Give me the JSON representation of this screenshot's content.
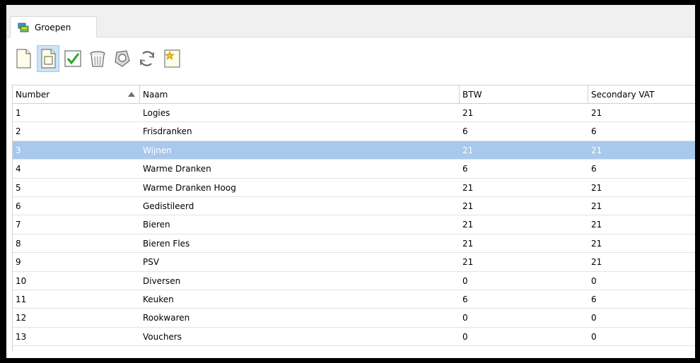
{
  "tab": {
    "label": "Groepen",
    "icon": "groups-icon"
  },
  "toolbar": {
    "buttons": [
      {
        "name": "new-button",
        "icon": "new-document-icon"
      },
      {
        "name": "edit-button",
        "icon": "edit-document-icon",
        "active": true
      },
      {
        "name": "confirm-button",
        "icon": "checkmark-icon"
      },
      {
        "name": "delete-button",
        "icon": "trash-icon"
      },
      {
        "name": "search-button",
        "icon": "search-icon"
      },
      {
        "name": "refresh-button",
        "icon": "refresh-icon"
      },
      {
        "name": "favorite-button",
        "icon": "star-icon"
      }
    ]
  },
  "table": {
    "columns": [
      "Number",
      "Naam",
      "BTW",
      "Secondary VAT"
    ],
    "sorted_column": "Number",
    "sort_direction": "ascending",
    "selected_row": "3",
    "rows": [
      [
        "1",
        "Logies",
        "21",
        "21"
      ],
      [
        "2",
        "Frisdranken",
        "6",
        "6"
      ],
      [
        "3",
        "Wijnen",
        "21",
        "21"
      ],
      [
        "4",
        "Warme Dranken",
        "6",
        "6"
      ],
      [
        "5",
        "Warme Dranken Hoog",
        "21",
        "21"
      ],
      [
        "6",
        "Gedistileerd",
        "21",
        "21"
      ],
      [
        "7",
        "Bieren",
        "21",
        "21"
      ],
      [
        "8",
        "Bieren Fles",
        "21",
        "21"
      ],
      [
        "9",
        "PSV",
        "21",
        "21"
      ],
      [
        "10",
        "Diversen",
        "0",
        "0"
      ],
      [
        "11",
        "Keuken",
        "6",
        "6"
      ],
      [
        "12",
        "Rookwaren",
        "0",
        "0"
      ],
      [
        "13",
        "Vouchers",
        "0",
        "0"
      ]
    ]
  },
  "colors": {
    "selection": "#a8c8ec",
    "toolbar_active": "#cce4f7",
    "check_green": "#2aa52a"
  }
}
